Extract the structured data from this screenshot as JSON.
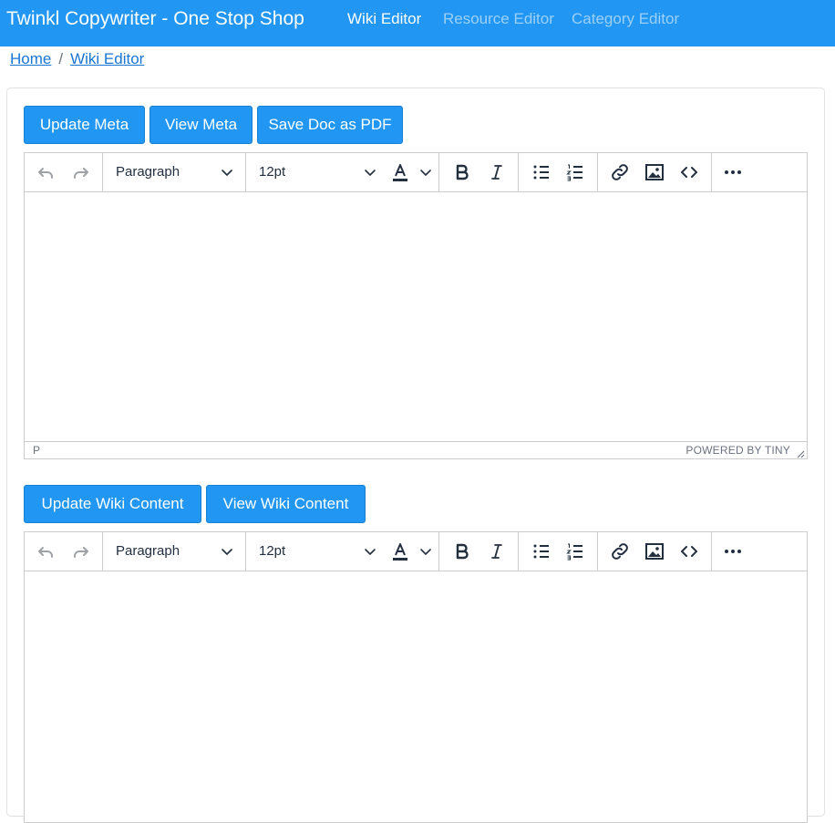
{
  "navbar": {
    "brand": "Twinkl Copywriter - One Stop Shop",
    "links": [
      {
        "label": "Wiki Editor",
        "active": true
      },
      {
        "label": "Resource Editor",
        "active": false
      },
      {
        "label": "Category Editor",
        "active": false
      }
    ],
    "color": "#2196f3"
  },
  "breadcrumb": {
    "items": [
      "Home",
      "Wiki Editor"
    ],
    "separator": "/"
  },
  "meta_section": {
    "buttons": {
      "update": "Update Meta",
      "view": "View Meta",
      "save_pdf": "Save Doc as PDF"
    },
    "editor": {
      "block_format": "Paragraph",
      "font_size": "12pt",
      "status_path": "P",
      "branding": "POWERED BY TINY"
    }
  },
  "wiki_section": {
    "buttons": {
      "update": "Update Wiki Content",
      "view": "View Wiki Content"
    },
    "editor": {
      "block_format": "Paragraph",
      "font_size": "12pt"
    }
  },
  "toolbar_icons": [
    "undo-icon",
    "redo-icon",
    "text-color-icon",
    "bold-icon",
    "italic-icon",
    "bullet-list-icon",
    "numbered-list-icon",
    "link-icon",
    "image-icon",
    "source-code-icon",
    "more-icon"
  ],
  "colors": {
    "button": "#2196f3",
    "link": "#1976d2",
    "icon": "#222f3e",
    "icon_disabled": "#9ea2a7"
  }
}
